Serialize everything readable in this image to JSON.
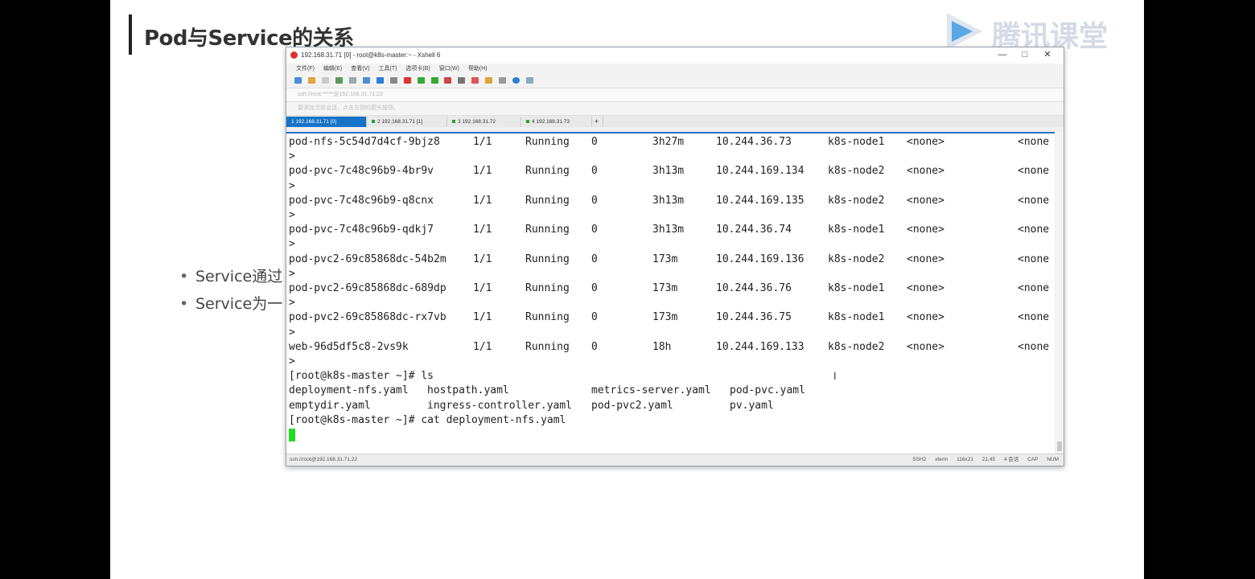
{
  "slide": {
    "title": "Pod与Service的关系",
    "logo_text": "腾讯课堂",
    "bullets": [
      "Service通过",
      "Service为一"
    ]
  },
  "window": {
    "title": "192.168.31.71 [0] - root@k8s-master:~ - Xshell 6",
    "controls": [
      "—",
      "□",
      "✕"
    ],
    "menu": [
      "文件(F)",
      "编辑(E)",
      "查看(V)",
      "工具(T)",
      "选项卡(B)",
      "窗口(W)",
      "帮助(H)"
    ],
    "address": "ssh://root:*****@192.168.31.71:22",
    "hint": "要添加当前会话，点击左侧的箭头按钮。",
    "tabs": [
      "1 192.168.31.71 [0]",
      "2 192.168.31.71 [1]",
      "3 192.168.31.72",
      "4 192.168.31.73",
      "+"
    ],
    "status": {
      "left": "ssh://root@192.168.31.71:22",
      "items": [
        "SSH2",
        "xterm",
        "116x21",
        "21,45",
        "4 会话",
        "CAP",
        "NUM"
      ]
    }
  },
  "terminal": {
    "pods": [
      [
        "pod-nfs-5c54d7d4cf-9bjz8",
        "1/1",
        "Running",
        "0",
        "3h27m",
        "10.244.36.73",
        "k8s-node1",
        "<none>",
        "<none"
      ],
      [
        "pod-pvc-7c48c96b9-4br9v",
        "1/1",
        "Running",
        "0",
        "3h13m",
        "10.244.169.134",
        "k8s-node2",
        "<none>",
        "<none"
      ],
      [
        "pod-pvc-7c48c96b9-q8cnx",
        "1/1",
        "Running",
        "0",
        "3h13m",
        "10.244.169.135",
        "k8s-node2",
        "<none>",
        "<none"
      ],
      [
        "pod-pvc-7c48c96b9-qdkj7",
        "1/1",
        "Running",
        "0",
        "3h13m",
        "10.244.36.74",
        "k8s-node1",
        "<none>",
        "<none"
      ],
      [
        "pod-pvc2-69c85868dc-54b2m",
        "1/1",
        "Running",
        "0",
        "173m",
        "10.244.169.136",
        "k8s-node2",
        "<none>",
        "<none"
      ],
      [
        "pod-pvc2-69c85868dc-689dp",
        "1/1",
        "Running",
        "0",
        "173m",
        "10.244.36.76",
        "k8s-node1",
        "<none>",
        "<none"
      ],
      [
        "pod-pvc2-69c85868dc-rx7vb",
        "1/1",
        "Running",
        "0",
        "173m",
        "10.244.36.75",
        "k8s-node1",
        "<none>",
        "<none"
      ],
      [
        "web-96d5df5c8-2vs9k",
        "1/1",
        "Running",
        "0",
        "18h",
        "10.244.169.133",
        "k8s-node2",
        "<none>",
        "<none"
      ]
    ],
    "continuation": ">",
    "prompt_ls": "[root@k8s-master ~]# ls",
    "files": [
      [
        "deployment-nfs.yaml",
        "hostpath.yaml",
        "metrics-server.yaml",
        "pod-pvc.yaml"
      ],
      [
        "emptydir.yaml",
        "ingress-controller.yaml",
        "pod-pvc2.yaml",
        "pv.yaml"
      ]
    ],
    "prompt_cat": "[root@k8s-master ~]# cat deployment-nfs.yaml",
    "mouse_cursor": "I"
  }
}
